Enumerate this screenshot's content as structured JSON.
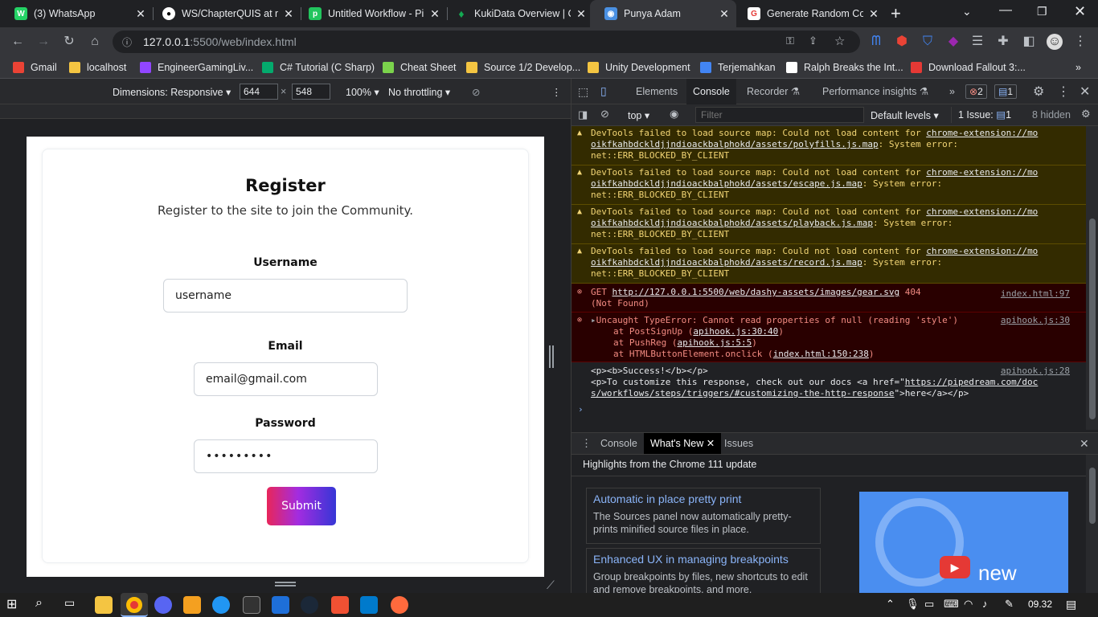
{
  "tabs": [
    {
      "title": "(3) WhatsApp",
      "icon": "whatsapp-icon",
      "color": "#25d366",
      "glyph": "W"
    },
    {
      "title": "WS/ChapterQUIS at m",
      "icon": "github-icon",
      "color": "#ffffff",
      "glyph": "G"
    },
    {
      "title": "Untitled Workflow - Pi",
      "icon": "pipedream-icon",
      "color": "#22c55e",
      "glyph": "p"
    },
    {
      "title": "KukiData Overview | C",
      "icon": "mongodb-leaf-icon",
      "color": "#13aa52",
      "glyph": "♦"
    },
    {
      "title": "Punya Adam",
      "icon": "site-icon",
      "color": "#4a90e2",
      "glyph": "◉"
    },
    {
      "title": "Generate Random Co",
      "icon": "generator-icon",
      "color": "#e53935",
      "glyph": "G"
    }
  ],
  "toolbar": {
    "url_prefix": "127.0.0.1",
    "url_rest": ":5500/web/index.html"
  },
  "bookmarks": [
    {
      "label": "Gmail",
      "color": "#ea4335"
    },
    {
      "label": "localhost",
      "color": "#f4c542"
    },
    {
      "label": "EngineerGamingLiv...",
      "color": "#9146ff"
    },
    {
      "label": "C# Tutorial (C Sharp)",
      "color": "#04aa6d"
    },
    {
      "label": "Cheat Sheet",
      "color": "#7bd34c"
    },
    {
      "label": "Source 1/2 Develop...",
      "color": "#f4c542"
    },
    {
      "label": "Unity Development",
      "color": "#f4c542"
    },
    {
      "label": "Terjemahkan",
      "color": "#4285f4"
    },
    {
      "label": "Ralph Breaks the Int...",
      "color": "#ffffff"
    },
    {
      "label": "Download Fallout 3:...",
      "color": "#e53935"
    }
  ],
  "device": {
    "dimensions": "Dimensions: Responsive",
    "width": "644",
    "height": "548",
    "zoom": "100%",
    "throttle": "No throttling",
    "times": "×"
  },
  "form": {
    "title": "Register",
    "subtitle": "Register to the site to join the Community.",
    "username_label": "Username",
    "username_value": "username",
    "email_label": "Email",
    "email_value": "email@gmail.com",
    "password_label": "Password",
    "password_value": "•••••••••",
    "submit": "Submit"
  },
  "devtools": {
    "tabs": [
      "Elements",
      "Console",
      "Recorder",
      "Performance insights"
    ],
    "error_count": "2",
    "info_count": "1",
    "context": "top",
    "filter_placeholder": "Filter",
    "levels": "Default levels",
    "issues": "1 Issue:",
    "issues_count": "1",
    "hidden": "8 hidden"
  },
  "console": {
    "warnings": [
      {
        "l1": "DevTools failed to load source map: Could not load content for ",
        "link1": "chrome-extension://mo",
        "l2": "oikfkahbdckldjjndioackbalphokd/assets/polyfills.js.map",
        "l2b": ": System error:",
        "l3": "net::ERR_BLOCKED_BY_CLIENT"
      },
      {
        "l1": "DevTools failed to load source map: Could not load content for ",
        "link1": "chrome-extension://mo",
        "l2": "oikfkahbdckldjjndioackbalphokd/assets/escape.js.map",
        "l2b": ": System error:",
        "l3": "net::ERR_BLOCKED_BY_CLIENT"
      },
      {
        "l1": "DevTools failed to load source map: Could not load content for ",
        "link1": "chrome-extension://mo",
        "l2": "oikfkahbdckldjjndioackbalphokd/assets/playback.js.map",
        "l2b": ": System error:",
        "l3": "net::ERR_BLOCKED_BY_CLIENT"
      },
      {
        "l1": "DevTools failed to load source map: Could not load content for ",
        "link1": "chrome-extension://mo",
        "l2": "oikfkahbdckldjjndioackbalphokd/assets/record.js.map",
        "l2b": ": System error:",
        "l3": "net::ERR_BLOCKED_BY_CLIENT"
      }
    ],
    "get_error": {
      "method": "GET",
      "url": "http://127.0.0.1:5500/web/dashy-assets/images/gear.svg",
      "status": "404",
      "status2": "(Not Found)",
      "src": "index.html:97"
    },
    "type_error": {
      "l1": "Uncaught TypeError: Cannot read properties of null (reading 'style')",
      "src": "apihook.js:30",
      "at1": "at PostSignUp (",
      "at1link": "apihook.js:30:40",
      "at2": "at PushReg (",
      "at2link": "apihook.js:5:5",
      "at3": "at HTMLButtonElement.onclick (",
      "at3link": "index.html:150:238",
      "close": ")"
    },
    "log": {
      "l1": "<p><b>Success!</b></p>",
      "src": "apihook.js:28",
      "l2": "<p>To customize this response, check out our docs <a href=\"",
      "l2link": "https://pipedream.com/doc",
      "l3link": "s/workflows/steps/triggers/#customizing-the-http-response",
      "l3": "\">here</a></p>"
    }
  },
  "drawer": {
    "tabs": [
      "Console",
      "What's New",
      "Issues"
    ],
    "heading": "Highlights from the Chrome 111 update",
    "cards": [
      {
        "title": "Automatic in place pretty print",
        "body": "The Sources panel now automatically pretty-prints minified source files in place."
      },
      {
        "title": "Enhanced UX in managing breakpoints",
        "body": "Group breakpoints by files, new shortcuts to edit and remove breakpoints, and more."
      }
    ],
    "promo_text": "new"
  },
  "taskbar": {
    "time": "09.32"
  }
}
